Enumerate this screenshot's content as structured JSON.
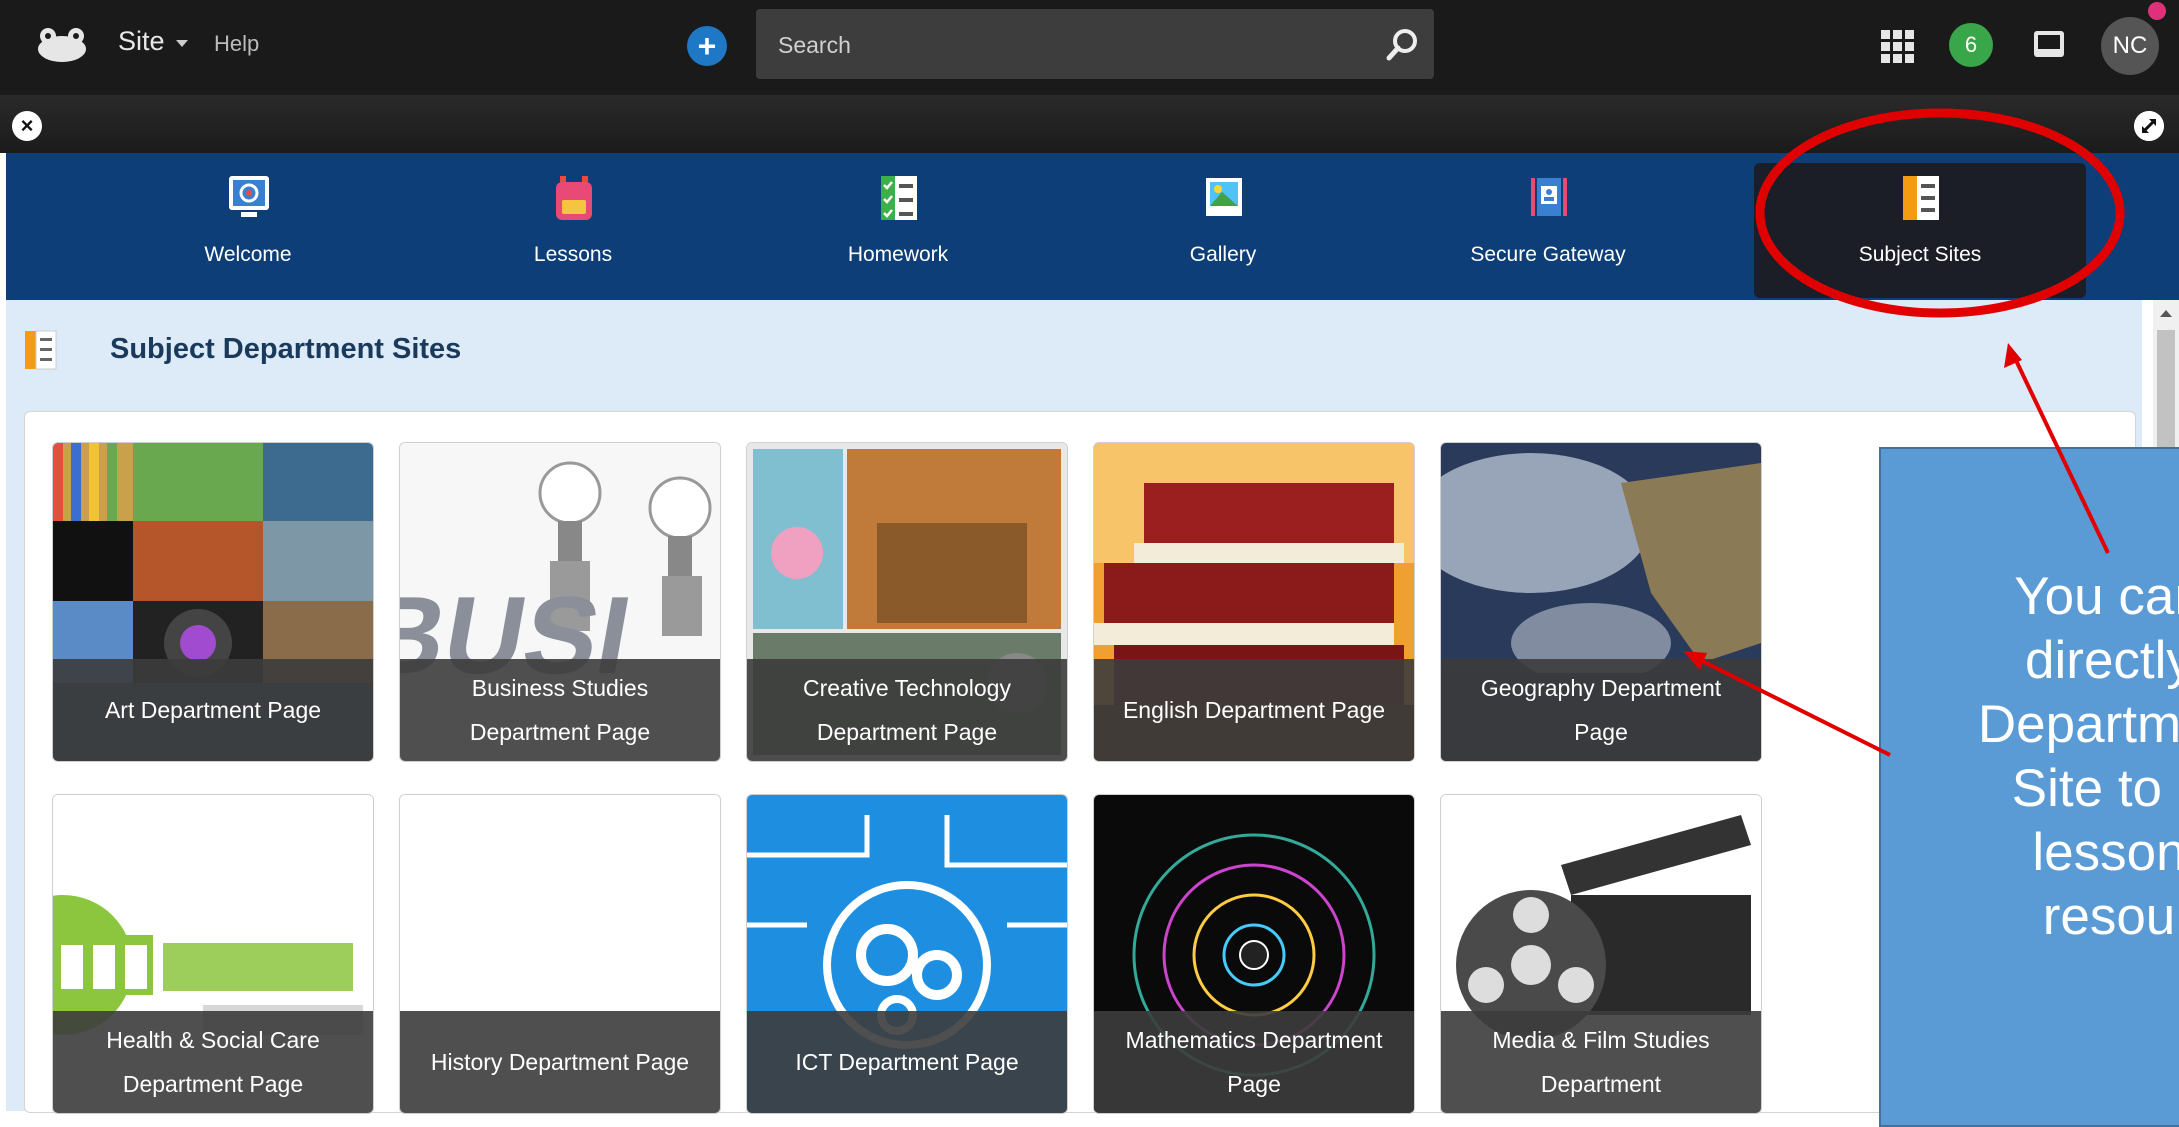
{
  "topbar": {
    "site_label": "Site",
    "help_label": "Help",
    "add_label": "+",
    "search_placeholder": "Search",
    "notification_count": "6",
    "avatar_initials": "NC"
  },
  "subbar": {
    "close_label": "×"
  },
  "nav": {
    "items": [
      {
        "label": "Welcome",
        "icon": "welcome-icon"
      },
      {
        "label": "Lessons",
        "icon": "lessons-icon"
      },
      {
        "label": "Homework",
        "icon": "homework-icon"
      },
      {
        "label": "Gallery",
        "icon": "gallery-icon"
      },
      {
        "label": "Secure Gateway",
        "icon": "secure-gateway-icon"
      },
      {
        "label": "Subject Sites",
        "icon": "subject-sites-icon",
        "active": true
      }
    ]
  },
  "section": {
    "title": "Subject Department Sites"
  },
  "tiles": [
    {
      "label": "Art Department Page"
    },
    {
      "label": "Business Studies Department Page"
    },
    {
      "label": "Creative Technology Department Page"
    },
    {
      "label": "English Department Page"
    },
    {
      "label": "Geography Department Page"
    },
    {
      "label": "Health & Social Care Department Page"
    },
    {
      "label": "History Department Page"
    },
    {
      "label": "ICT Department Page"
    },
    {
      "label": "Mathematics Department Page"
    },
    {
      "label": "Media & Film Studies Department"
    }
  ],
  "annotation": {
    "text_lines": [
      "You can",
      "directly",
      "Departmen",
      "Site to a",
      "lesson",
      "resou"
    ]
  },
  "colors": {
    "topbar": "#1a1a1a",
    "navbar": "#0d3e77",
    "content_bg": "#ddeaf7",
    "callout": "#5b9bd5",
    "annotation_red": "#e00000"
  }
}
